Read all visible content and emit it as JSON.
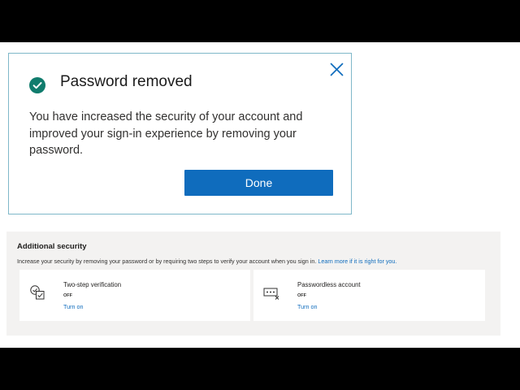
{
  "dialog": {
    "title": "Password removed",
    "message": "You have increased the security of your account and improved your sign-in experience by removing your password.",
    "done_label": "Done",
    "accent_color": "#0f6cbd",
    "success_color": "#107c6d",
    "icons": {
      "status": "check-circle-icon",
      "close": "close-icon"
    }
  },
  "additional_security": {
    "heading": "Additional security",
    "description": "Increase your security by removing your password or by requiring two steps to verify your account when you sign in.",
    "learn_more": "Learn more if it is right for you.",
    "cards": [
      {
        "title": "Two-step verification",
        "status": "OFF",
        "action": "Turn on",
        "icon": "verification-icon"
      },
      {
        "title": "Passwordless account",
        "status": "OFF",
        "action": "Turn on",
        "icon": "passwordless-icon"
      }
    ]
  }
}
